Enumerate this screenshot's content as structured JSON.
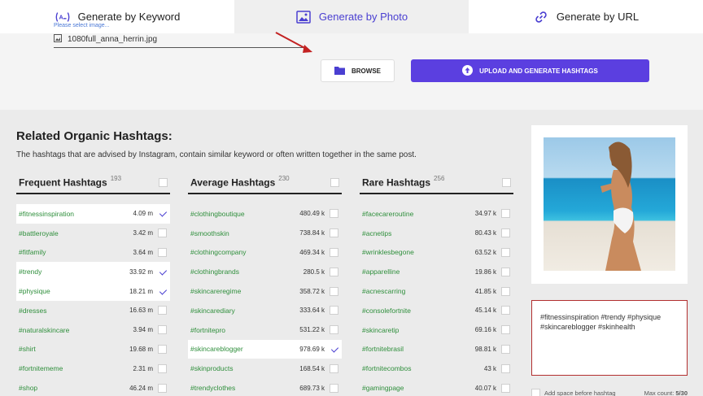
{
  "tabs": [
    {
      "label": "Generate by Keyword",
      "icon": "keyword-icon"
    },
    {
      "label": "Generate by Photo",
      "icon": "image-icon"
    },
    {
      "label": "Generate by URL",
      "icon": "link-icon"
    }
  ],
  "upload": {
    "label": "Please select image...",
    "filename": "1080full_anna_herrin.jpg",
    "browse_label": "BROWSE",
    "generate_label": "UPLOAD AND GENERATE HASHTAGS"
  },
  "section": {
    "title": "Related Organic Hashtags:",
    "description": "The hashtags that are advised by Instagram, contain similar keyword or often written together in the same post."
  },
  "columns": [
    {
      "title": "Frequent Hashtags",
      "count": "193",
      "rows": [
        {
          "tag": "#fitnessinspiration",
          "value": "4.09 m",
          "checked": true
        },
        {
          "tag": "#battleroyale",
          "value": "3.42 m",
          "checked": false
        },
        {
          "tag": "#fitfamily",
          "value": "3.64 m",
          "checked": false
        },
        {
          "tag": "#trendy",
          "value": "33.92 m",
          "checked": true
        },
        {
          "tag": "#physique",
          "value": "18.21 m",
          "checked": true
        },
        {
          "tag": "#dresses",
          "value": "16.63 m",
          "checked": false
        },
        {
          "tag": "#naturalskincare",
          "value": "3.94 m",
          "checked": false
        },
        {
          "tag": "#shirt",
          "value": "19.68 m",
          "checked": false
        },
        {
          "tag": "#fortnitememe",
          "value": "2.31 m",
          "checked": false
        },
        {
          "tag": "#shop",
          "value": "46.24 m",
          "checked": false
        }
      ]
    },
    {
      "title": "Average Hashtags",
      "count": "230",
      "rows": [
        {
          "tag": "#clothingboutique",
          "value": "480.49 k",
          "checked": false
        },
        {
          "tag": "#smoothskin",
          "value": "738.84 k",
          "checked": false
        },
        {
          "tag": "#clothingcompany",
          "value": "469.34 k",
          "checked": false
        },
        {
          "tag": "#clothingbrands",
          "value": "280.5 k",
          "checked": false
        },
        {
          "tag": "#skincareregime",
          "value": "358.72 k",
          "checked": false
        },
        {
          "tag": "#skincarediary",
          "value": "333.64 k",
          "checked": false
        },
        {
          "tag": "#fortnitepro",
          "value": "531.22 k",
          "checked": false
        },
        {
          "tag": "#skincareblogger",
          "value": "978.69 k",
          "checked": true
        },
        {
          "tag": "#skinproducts",
          "value": "168.54 k",
          "checked": false
        },
        {
          "tag": "#trendyclothes",
          "value": "689.73 k",
          "checked": false
        }
      ]
    },
    {
      "title": "Rare Hashtags",
      "count": "256",
      "rows": [
        {
          "tag": "#facecareroutine",
          "value": "34.97 k",
          "checked": false
        },
        {
          "tag": "#acnetips",
          "value": "80.43 k",
          "checked": false
        },
        {
          "tag": "#wrinklesbegone",
          "value": "63.52 k",
          "checked": false
        },
        {
          "tag": "#apparelline",
          "value": "19.86 k",
          "checked": false
        },
        {
          "tag": "#acnescarring",
          "value": "41.85 k",
          "checked": false
        },
        {
          "tag": "#consolefortnite",
          "value": "45.14 k",
          "checked": false
        },
        {
          "tag": "#skincaretip",
          "value": "69.16 k",
          "checked": false
        },
        {
          "tag": "#fortnitebrasil",
          "value": "98.81 k",
          "checked": false
        },
        {
          "tag": "#fortnitecombos",
          "value": "43 k",
          "checked": false
        },
        {
          "tag": "#gamingpage",
          "value": "40.07 k",
          "checked": false
        }
      ]
    }
  ],
  "output": {
    "text": "#fitnessinspiration #trendy #physique #skincareblogger #skinhealth",
    "option_label": "Add space before hashtag",
    "max_count_label": "Max count: ",
    "max_count_value": "5/30"
  },
  "colors": {
    "accent": "#5b3fe0",
    "tag_green": "#2f8f3c",
    "box_border": "#b22f2f"
  }
}
